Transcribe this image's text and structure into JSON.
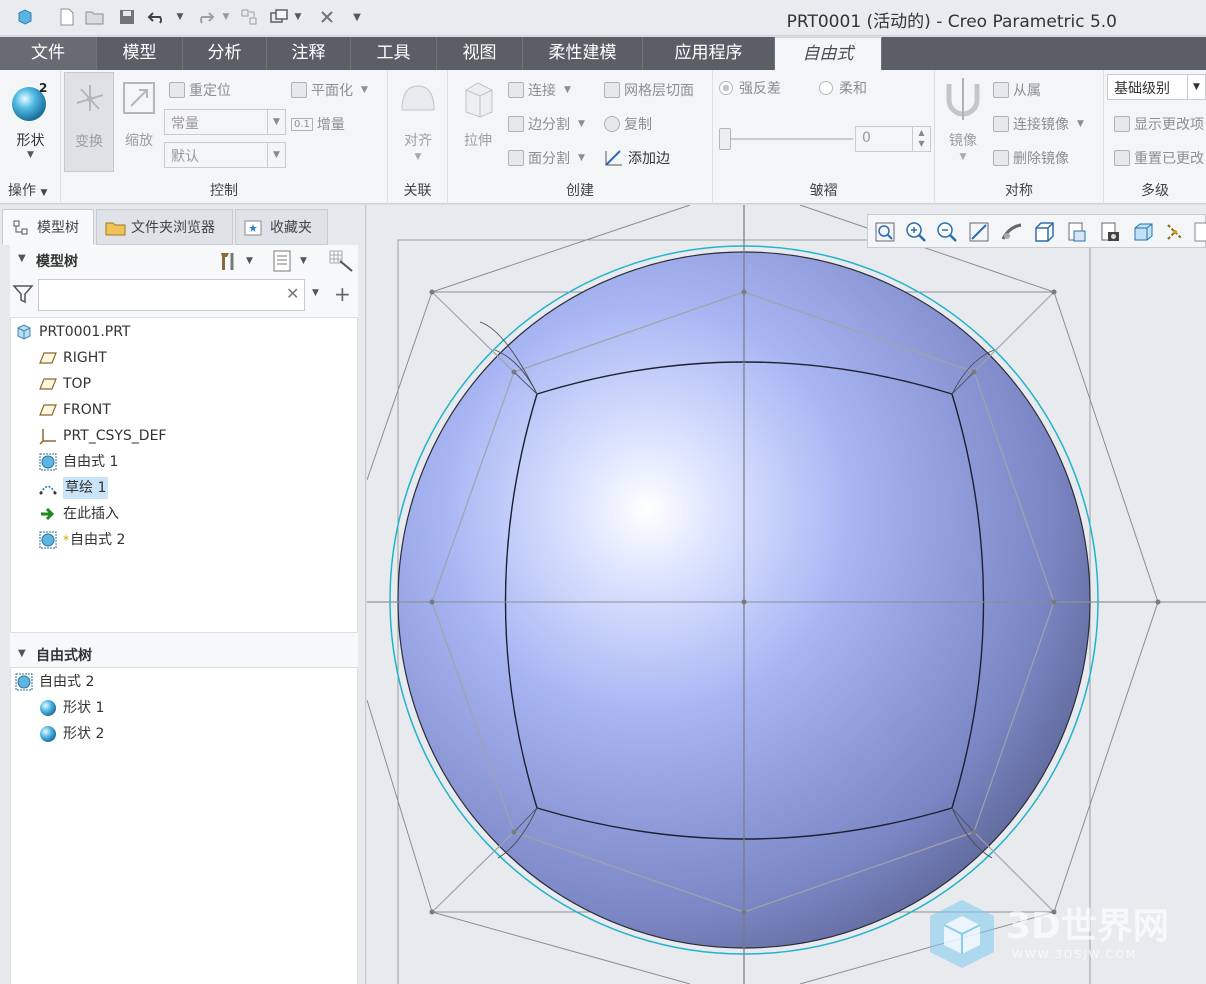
{
  "window": {
    "title": "PRT0001 (活动的) - Creo Parametric 5.0"
  },
  "quick_access": [
    "new-icon",
    "open-icon",
    "save-icon",
    "undo-icon",
    "redo-icon",
    "regenerate-icon",
    "windows-icon",
    "close-icon",
    "customize-icon"
  ],
  "tabs": [
    {
      "label": "文件"
    },
    {
      "label": "模型"
    },
    {
      "label": "分析"
    },
    {
      "label": "注释"
    },
    {
      "label": "工具"
    },
    {
      "label": "视图"
    },
    {
      "label": "柔性建模"
    },
    {
      "label": "应用程序"
    },
    {
      "label": "自由式"
    }
  ],
  "ribbon": {
    "operations": {
      "shape_label": "形状",
      "group_label": "操作",
      "shape_badge": "2"
    },
    "control": {
      "transform": "变换",
      "scale": "缩放",
      "reposition": "重定位",
      "constant": "常量",
      "default": "默认",
      "flatten": "平面化",
      "increment": "增量",
      "increment_badge": "0.1",
      "group_label": "控制"
    },
    "association": {
      "align": "对齐",
      "group_label": "关联"
    },
    "create": {
      "extrude": "拉伸",
      "connect": "连接",
      "edge_split": "边分割",
      "face_split": "面分割",
      "mesh_cut": "网格层切面",
      "copy": "复制",
      "add_edge": "添加边",
      "group_label": "创建"
    },
    "crease": {
      "strong": "强反差",
      "soft": "柔和",
      "value": "0",
      "group_label": "皱褶"
    },
    "symmetry": {
      "mirror": "镜像",
      "follow": "从属",
      "connect_mirror": "连接镜像",
      "delete_mirror": "删除镜像",
      "group_label": "对称"
    },
    "multilevel": {
      "level": "基础级别",
      "show_changes": "显示更改项",
      "reset_changes": "重置已更改",
      "group_label": "多级"
    }
  },
  "left_panel": {
    "tabs": [
      {
        "label": "模型树"
      },
      {
        "label": "文件夹浏览器"
      },
      {
        "label": "收藏夹"
      }
    ],
    "model_tree_header": "模型树",
    "search_value": "",
    "model_tree": [
      {
        "label": "PRT0001.PRT",
        "icon": "part-icon"
      },
      {
        "label": "RIGHT",
        "icon": "datum-plane-icon"
      },
      {
        "label": "TOP",
        "icon": "datum-plane-icon"
      },
      {
        "label": "FRONT",
        "icon": "datum-plane-icon"
      },
      {
        "label": "PRT_CSYS_DEF",
        "icon": "csys-icon"
      },
      {
        "label": "自由式 1",
        "icon": "freestyle-icon"
      },
      {
        "label": "草绘 1",
        "icon": "sketch-icon",
        "selected": true
      },
      {
        "label": "在此插入",
        "icon": "insert-here-icon"
      },
      {
        "label": "自由式 2",
        "icon": "freestyle-icon",
        "marker": "*"
      }
    ],
    "freestyle_tree_header": "自由式树",
    "freestyle_tree": [
      {
        "label": "自由式 2",
        "icon": "freestyle-icon"
      },
      {
        "label": "形状 1",
        "icon": "sphere-icon"
      },
      {
        "label": "形状 2",
        "icon": "sphere-icon"
      }
    ]
  },
  "view_toolbar": [
    "refit-icon",
    "zoom-in-icon",
    "zoom-out-icon",
    "repaint-icon",
    "perspective-icon",
    "display-style-icon",
    "saved-orientations-icon",
    "view-manager-icon",
    "datum-display-icon",
    "spin-center-icon",
    "annotation-display-icon"
  ],
  "watermark": {
    "brand": "3D世界网",
    "url": "WWW.3DSJW.COM"
  },
  "colors": {
    "tab_bar": "#5a5f66",
    "sphere_light": "#c6d2ff",
    "sphere_dark": "#5a6290",
    "accent": "#1aa8c8"
  }
}
